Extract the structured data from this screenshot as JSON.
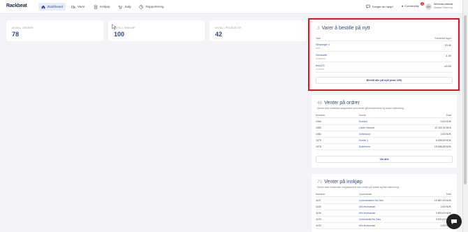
{
  "app": {
    "logo": "Rackbeat"
  },
  "nav": [
    {
      "label": "Dashboard",
      "icon": "home-icon",
      "active": true
    },
    {
      "label": "Varer",
      "icon": "truck-icon",
      "active": false
    },
    {
      "label": "Innkjøp",
      "icon": "clipboard-icon",
      "active": false
    },
    {
      "label": "Salg",
      "icon": "cart-icon",
      "active": false
    },
    {
      "label": "Rapportering",
      "icon": "report-icon",
      "active": false
    }
  ],
  "header": {
    "help_label": "Trenger du hjelp?",
    "community_label": "Community",
    "notification_count": "1",
    "avatar_initials": "MH",
    "user_line1": "Wichman Internal",
    "user_line2": "Madsen Rønning"
  },
  "stats": [
    {
      "label": "ANTALL ORDRER",
      "value": "78"
    },
    {
      "label": "ANTALL INNKJØP",
      "value": "100"
    },
    {
      "label": "ANTALL PRODUKTER",
      "value": "42"
    }
  ],
  "reorder": {
    "count": "3",
    "title": "Varer å bestille på nytt",
    "col_item": "Vare",
    "col_stock": "Forventet lager",
    "items": [
      {
        "name": "Simpleget 1",
        "code": "3001",
        "qty": "15.40"
      },
      {
        "name": "Steckwell",
        "code": "1016T01A",
        "qty": "-1.00"
      },
      {
        "name": "test123",
        "code": "1014T03",
        "qty": "-40.00"
      }
    ],
    "button_label": "Bestill alle på nytt (max 100)"
  },
  "orders": {
    "count": "46",
    "title": "Venter på ordrer",
    "description": "Denne viser innkeldan sørgsordrer som venter på fremsendene og annen fakturering.",
    "col_number": "Nummer",
    "col_customer": "Kunde",
    "col_total": "Total",
    "rows": [
      {
        "number": "1084",
        "customer": "Kunde4",
        "total": "0,00 NOK"
      },
      {
        "number": "1083",
        "customer": "Carlie Internal",
        "total": "12 100,00 DKK"
      },
      {
        "number": "1082",
        "customer": "Sofiehund",
        "total": "0,00 NOK"
      },
      {
        "number": "1079",
        "customer": "Kunde 1",
        "total": "9 028,95 NOK"
      },
      {
        "number": "1078",
        "customer": "Sofiehund",
        "total": "19 188,28 NOK"
      }
    ],
    "button_label": "Vis alle"
  },
  "purchases": {
    "count": "70",
    "title": "Venter på innkjøp",
    "description": "Denne viser innkelsdan innkjøpsordrer som venter på mottak og ikke fakturering.",
    "col_number": "Nummer",
    "col_supplier": "Leverandør",
    "col_total": "Total",
    "rows": [
      {
        "number": "1107",
        "supplier": "Leverandøren fra Oslo",
        "total": "19 687,00 NOK"
      },
      {
        "number": "1105",
        "supplier": "Min leverandør",
        "total": "0,00 NOK"
      },
      {
        "number": "1104",
        "supplier": "Min leverandør",
        "total": "3 900,00 NOK"
      },
      {
        "number": "1103",
        "supplier": "Leverandør fra Oslo",
        "total": "3 000,00 NOK"
      },
      {
        "number": "1102",
        "supplier": "Min leverandør",
        "total": "0,00 NOK"
      }
    ]
  }
}
